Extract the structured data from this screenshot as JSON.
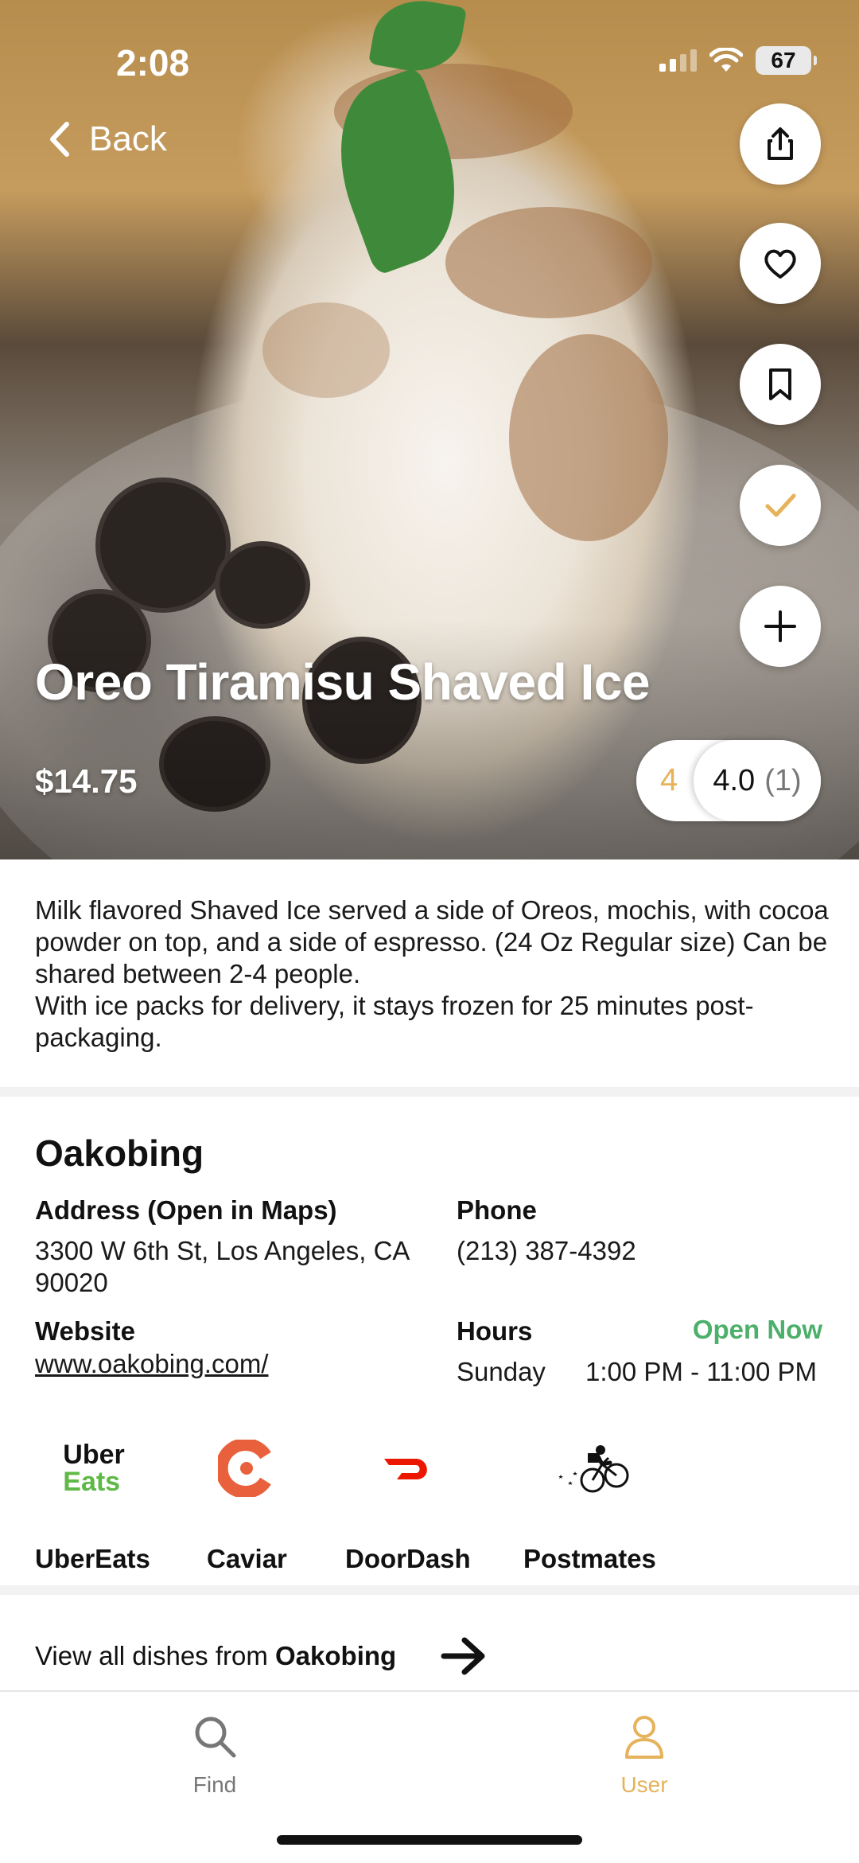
{
  "status_bar": {
    "time": "2:08",
    "battery": "67"
  },
  "nav": {
    "back_label": "Back"
  },
  "dish": {
    "title": "Oreo Tiramisu Shaved Ice",
    "price": "$14.75",
    "my_rating": "4",
    "avg_rating": "4.0",
    "rating_count": "(1)",
    "description": "Milk flavored Shaved Ice served a side of Oreos, mochis, with cocoa powder on top, and a side of espresso. (24 Oz Regular size) Can be shared between 2-4 people.\nWith ice packs for delivery, it stays frozen for 25 minutes post-packaging."
  },
  "actions": [
    "share-icon",
    "heart-icon",
    "bookmark-icon",
    "check-icon",
    "plus-icon"
  ],
  "restaurant": {
    "name": "Oakobing",
    "address_label": "Address (Open in Maps)",
    "address": "3300 W 6th St, Los Angeles, CA 90020",
    "phone_label": "Phone",
    "phone": "(213) 387-4392",
    "website_label": "Website",
    "website": "www.oakobing.com/",
    "hours_label": "Hours",
    "open_status": "Open Now",
    "hours_day": "Sunday",
    "hours_time": "1:00 PM - 11:00 PM"
  },
  "services": {
    "uber_logo_top": "Uber",
    "uber_logo_bottom": "Eats",
    "ubereats": "UberEats",
    "caviar": "Caviar",
    "doordash": "DoorDash",
    "postmates": "Postmates"
  },
  "view_all": {
    "prefix": "View all dishes from ",
    "restaurant": "Oakobing"
  },
  "tabs": {
    "find": "Find",
    "user": "User"
  },
  "colors": {
    "accent": "#e6b25a",
    "open": "#4caf6a",
    "caviar": "#e8603c",
    "doordash": "#eb1700",
    "uber_green": "#5fb946"
  }
}
